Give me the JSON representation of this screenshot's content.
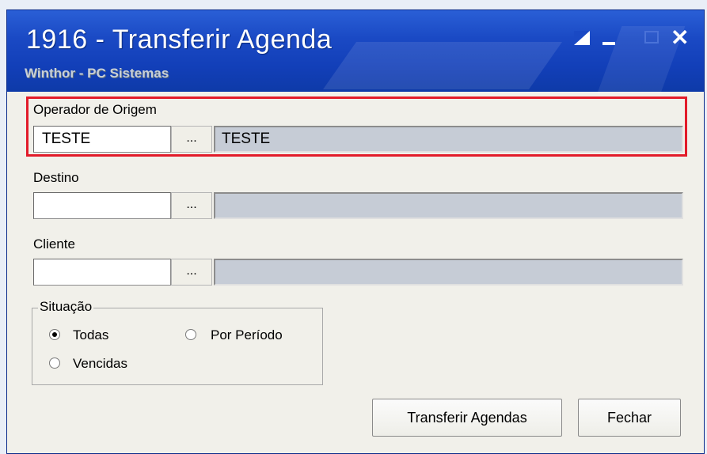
{
  "window": {
    "title": "1916 - Transferir Agenda",
    "subtitle": "Winthor - PC Sistemas"
  },
  "titlebar_buttons": {
    "close_glyph": "✕"
  },
  "origem": {
    "label": "Operador de Origem",
    "code_value": "TESTE",
    "lookup_label": "...",
    "description_value": "TESTE"
  },
  "destino": {
    "label": "Destino",
    "code_value": "",
    "lookup_label": "...",
    "description_value": ""
  },
  "cliente": {
    "label": "Cliente",
    "code_value": "",
    "lookup_label": "...",
    "description_value": ""
  },
  "situacao": {
    "title": "Situação",
    "options": [
      {
        "label": "Todas",
        "selected": true
      },
      {
        "label": "Por Período",
        "selected": false
      },
      {
        "label": "Vencidas",
        "selected": false
      }
    ]
  },
  "actions": {
    "transfer_label": "Transferir Agendas",
    "close_label": "Fechar"
  },
  "colors": {
    "highlight": "#e21b2a",
    "titlebar": "#1a49c4"
  }
}
